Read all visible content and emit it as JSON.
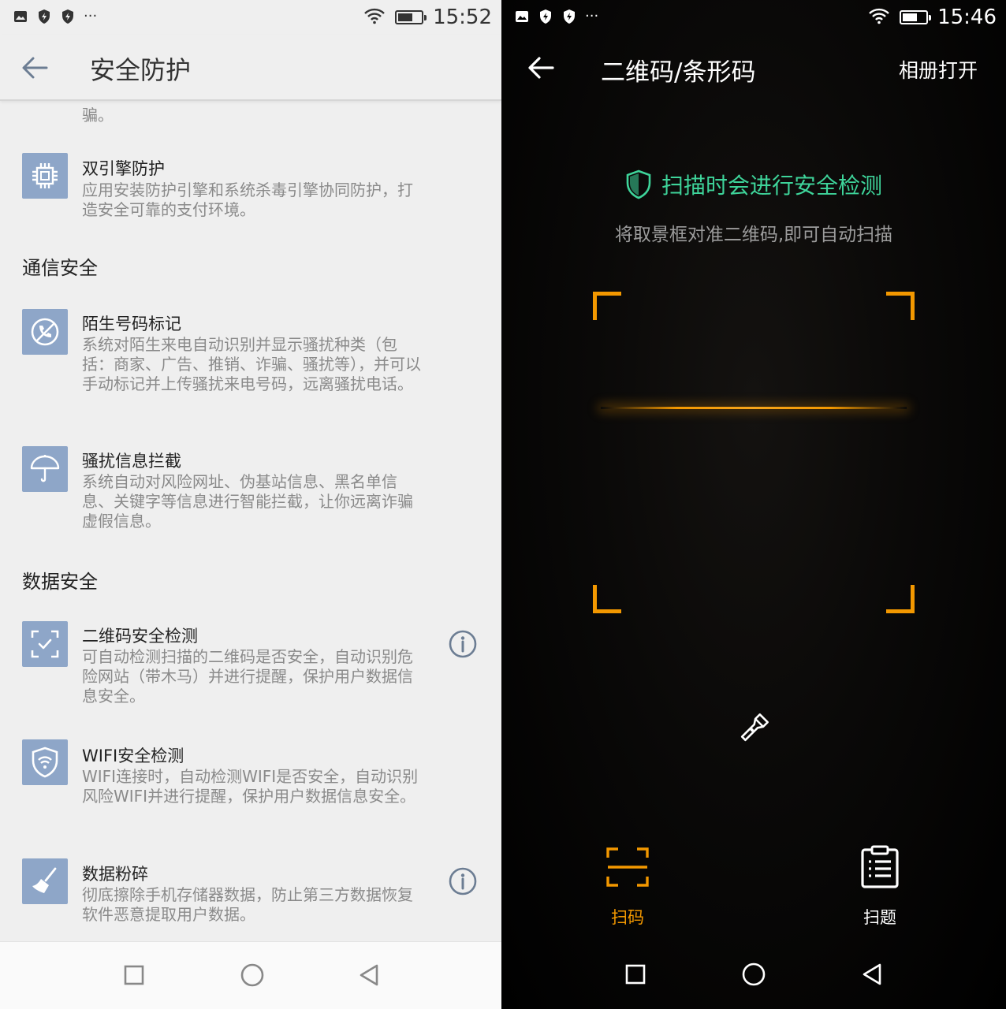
{
  "left": {
    "status": {
      "time": "15:52",
      "more": "···"
    },
    "header": {
      "title": "安全防护"
    },
    "cutoff_text": "骗。",
    "items": [
      {
        "title": "双引擎防护",
        "desc": "应用安装防护引擎和系统杀毒引擎协同防护，打造安全可靠的支付环境。",
        "icon": "chip-icon"
      },
      {
        "title": "陌生号码标记",
        "desc": "系统对陌生来电自动识别并显示骚扰种类（包括：商家、广告、推销、诈骗、骚扰等），并可以手动标记并上传骚扰来电号码，远离骚扰电话。",
        "icon": "phone-block-icon"
      },
      {
        "title": "骚扰信息拦截",
        "desc": "系统自动对风险网址、伪基站信息、黑名单信息、关键字等信息进行智能拦截，让你远离诈骗虚假信息。",
        "icon": "umbrella-icon"
      },
      {
        "title": "二维码安全检测",
        "desc": "可自动检测扫描的二维码是否安全，自动识别危险网站（带木马）并进行提醒，保护用户数据信息安全。",
        "icon": "qr-scan-icon"
      },
      {
        "title": "WIFI安全检测",
        "desc": "WIFI连接时，自动检测WIFI是否安全，自动识别风险WIFI并进行提醒，保护用户数据信息安全。",
        "icon": "wifi-shield-icon"
      },
      {
        "title": "数据粉碎",
        "desc": "彻底擦除手机存储器数据，防止第三方数据恢复软件恶意提取用户数据。",
        "icon": "broom-icon"
      }
    ],
    "sections": {
      "comm": "通信安全",
      "data": "数据安全"
    }
  },
  "right": {
    "status": {
      "time": "15:46",
      "more": "···"
    },
    "header": {
      "title": "二维码/条形码",
      "album": "相册打开"
    },
    "banner": "扫描时会进行安全检测",
    "hint": "将取景框对准二维码,即可自动扫描",
    "modes": {
      "scan": "扫码",
      "question": "扫题"
    }
  },
  "colors": {
    "accent": "#f39800",
    "secure_green": "#3ed49a",
    "icon_bg": "#8ea6c8"
  }
}
